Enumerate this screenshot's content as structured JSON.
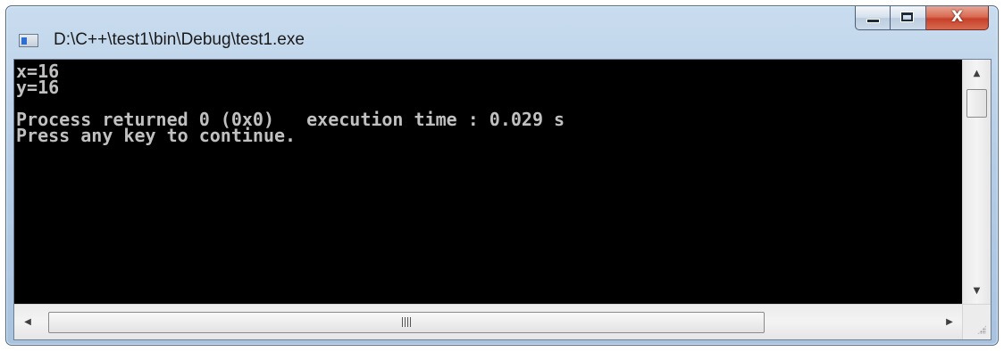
{
  "window": {
    "title": "D:\\C++\\test1\\bin\\Debug\\test1.exe",
    "icon": "console-app-icon",
    "buttons": {
      "minimize": "minimize-icon",
      "maximize": "maximize-icon",
      "close": "close-icon"
    }
  },
  "console": {
    "lines": [
      "x=16",
      "y=16",
      "",
      "Process returned 0 (0x0)   execution time : 0.029 s",
      "Press any key to continue."
    ],
    "text_color": "#c0c0c0",
    "background_color": "#000000"
  },
  "colors": {
    "close_button": "#c7412a",
    "frame": "#b6cde6"
  }
}
